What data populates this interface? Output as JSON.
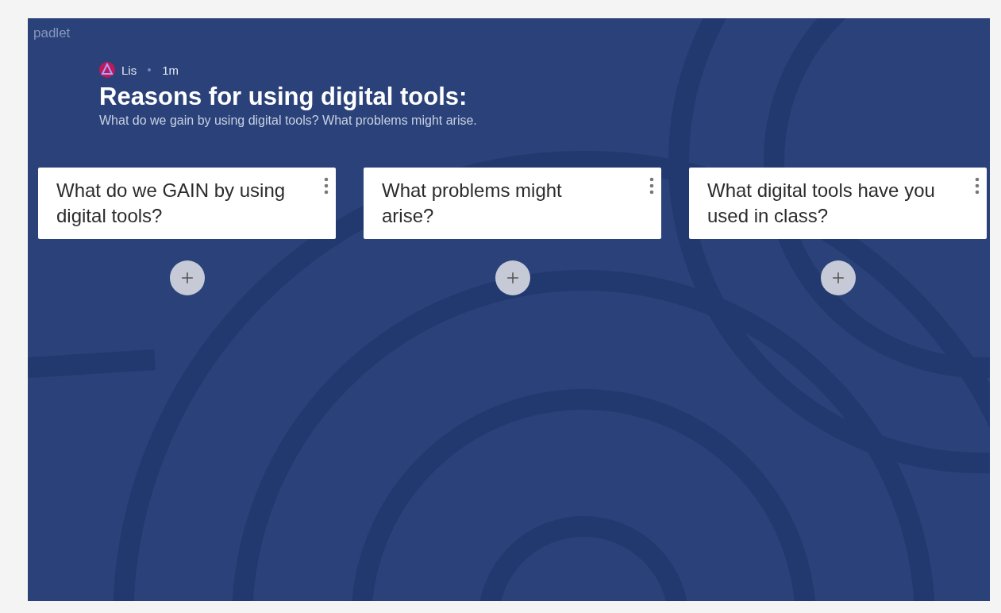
{
  "brand": "padlet",
  "author": {
    "name": "Lis",
    "time": "1m"
  },
  "title": "Reasons for using digital tools:",
  "description": "What do we gain by using digital tools? What problems might arise.",
  "columns": [
    {
      "title": "What do we GAIN by using digital tools?"
    },
    {
      "title": "What problems might arise?"
    },
    {
      "title": "What digital tools have you used in class?"
    }
  ]
}
